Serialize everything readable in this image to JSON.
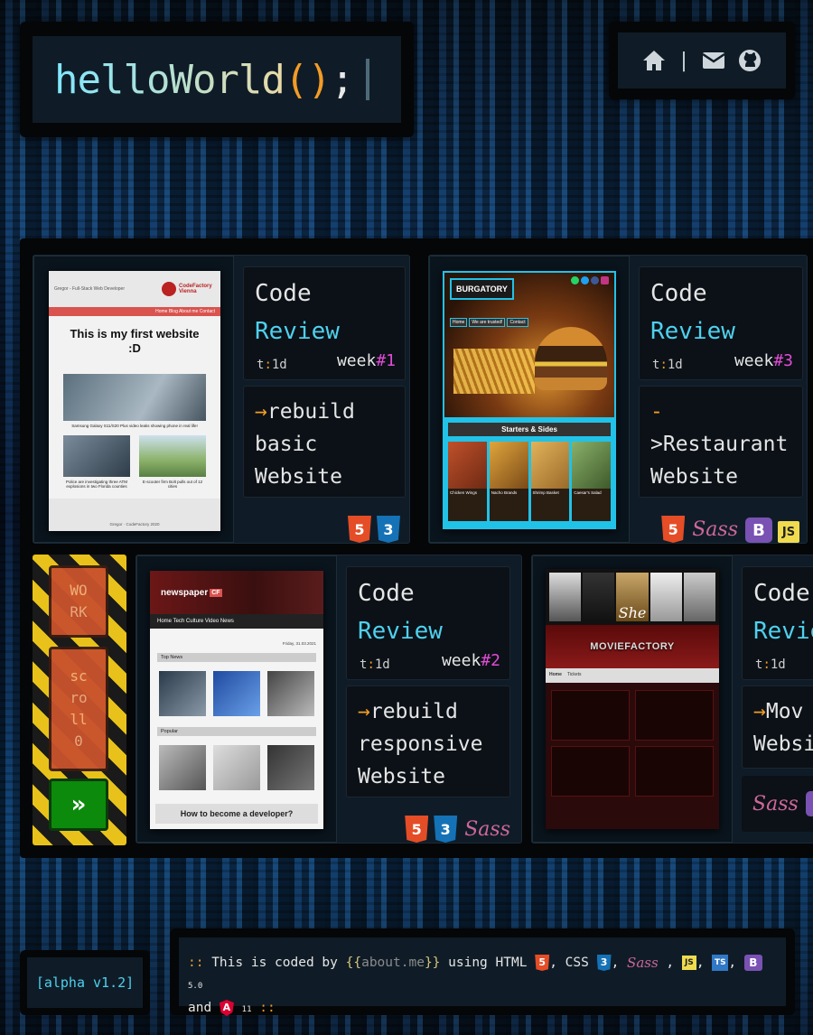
{
  "header": {
    "logo": {
      "name": "helloWorld",
      "paren": "()",
      "semi": ";"
    },
    "nav": [
      {
        "icon": "home-icon",
        "label": "Home"
      },
      {
        "icon": "mail-icon",
        "label": "Mail"
      },
      {
        "icon": "github-icon",
        "label": "GitHub"
      }
    ],
    "nav_separator": "|"
  },
  "projects": [
    {
      "title_line1": "Code",
      "title_line2": "Review",
      "time_prefix": "t",
      "time_colon": ":",
      "time_value": "1d",
      "week_label": "week",
      "week_number": "#1",
      "desc_arrow": "→",
      "desc_line1": "rebuild",
      "desc_line2": "basic",
      "desc_line3": "Website",
      "badges": [
        "5",
        "3"
      ],
      "screenshot": {
        "header_left": "Gregor - Full-Stack Web Developer",
        "brand": "CodeFactory Vienna",
        "nav": "Home  Blog  About me  Contact",
        "headline": "This is my first website :D",
        "caption1": "Samsung Galaxy S11/S20 Plus video leaks showing phone in real life!",
        "caption2": "Police are investigating three ATM explosions in two Florida counties",
        "caption3": "E-scooter firm Bolt pulls out of 12 cities",
        "footer": "Gregor · CodeFactory 2020"
      }
    },
    {
      "title_line1": "Code",
      "title_line2": "Review",
      "time_prefix": "t",
      "time_colon": ":",
      "time_value": "1d",
      "week_label": "week",
      "week_number": "#3",
      "desc_line1": "-",
      "desc_line2": ">Restaurant",
      "desc_line3": "Website",
      "badges": [
        "5",
        "Sass",
        "B",
        "JS"
      ],
      "screenshot": {
        "brand": "BURGATORY",
        "nav1": "Home",
        "nav2": "We are trusted!",
        "nav3": "Contact",
        "section": "Starters & Sides",
        "items": [
          "Chicken Wings",
          "Nacho Brands",
          "Shrimp Basket",
          "Caesar's Salad"
        ]
      }
    },
    {
      "title_line1": "Code",
      "title_line2": "Review",
      "time_prefix": "t",
      "time_colon": ":",
      "time_value": "1d",
      "week_label": "week",
      "week_number": "#2",
      "desc_arrow": "→",
      "desc_line1": "rebuild",
      "desc_line2": "responsive",
      "desc_line3": "Website",
      "badges": [
        "5",
        "3",
        "Sass"
      ],
      "screenshot": {
        "brand": "newspaper",
        "brand_badge": "CF",
        "nav": "Home  Tech  Culture  Video  News",
        "date": "Friday, 31.03.2021",
        "section1": "Top News",
        "section2": "Popular",
        "footer": "How to become a developer?"
      }
    },
    {
      "title_line1": "Code",
      "title_line2": "Revie",
      "time_prefix": "t",
      "time_colon": ":",
      "time_value": "1d",
      "desc_arrow": "→",
      "desc_line1": "Mov",
      "desc_line2": "Websi",
      "badges": [
        "Sass",
        "B"
      ],
      "screenshot": {
        "brand": "MOVIEFACTORY",
        "nav1": "Home",
        "nav2": "Tickets",
        "poster_title": "She"
      }
    }
  ],
  "work_scroll": {
    "box1": "WO\nRK",
    "box2": "sc\nro\nll\n0",
    "next": "»"
  },
  "footer": {
    "version": "[alpha v1.2]",
    "about": {
      "prefix": "::",
      "text1": "This is coded by",
      "brace_open": "{{",
      "tmpl": "about.me",
      "brace_close": "}}",
      "text2": "using HTML",
      "text3": ", CSS",
      "comma": ",",
      "bootstrap_version": "5.0",
      "and": "and",
      "angular_version": "11",
      "suffix": "::"
    }
  },
  "colors": {
    "accent_cyan": "#4fd0ee",
    "accent_orange": "#f39c26",
    "accent_magenta": "#e24bd6",
    "panel": "#0f1c27"
  }
}
